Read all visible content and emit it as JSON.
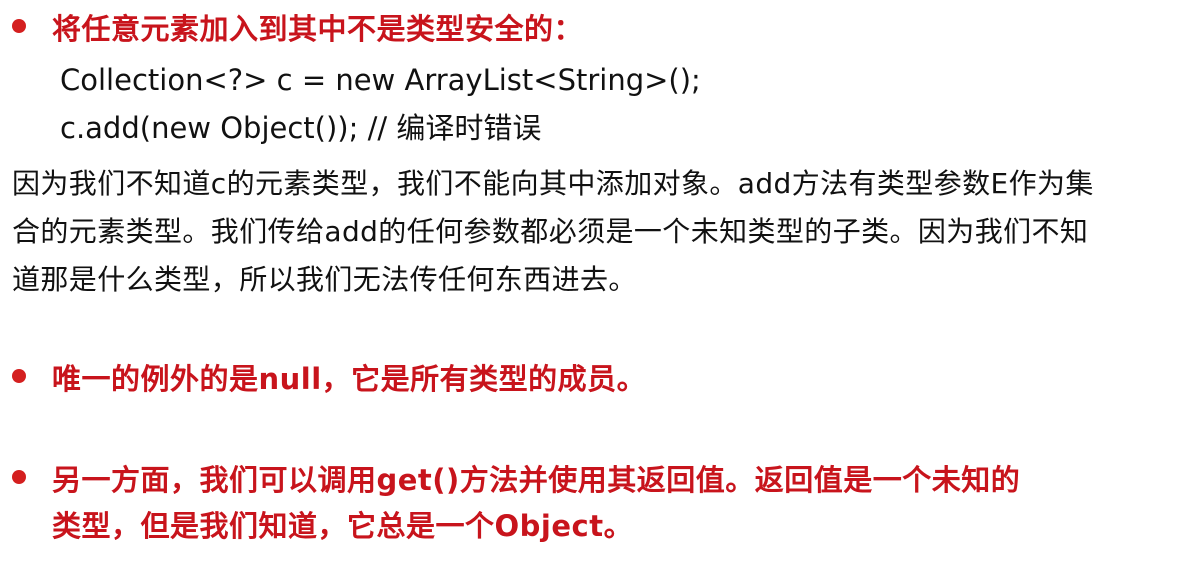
{
  "colors": {
    "accent_red": "#c8141c",
    "bullet_red": "#d41f1f",
    "body_text": "#111111",
    "background": "#ffffff"
  },
  "bullet1": {
    "icon": "red-bullet-dot",
    "text": "将任意元素加入到其中不是类型安全的："
  },
  "code": {
    "line1": "Collection<?> c = new ArrayList<String>();",
    "line2": "c.add(new Object()); // 编译时错误"
  },
  "paragraph": {
    "line1": "因为我们不知道c的元素类型，我们不能向其中添加对象。add方法有类型参数E作为集",
    "line2": "合的元素类型。我们传给add的任何参数都必须是一个未知类型的子类。因为我们不知",
    "line3": "道那是什么类型，所以我们无法传任何东西进去。"
  },
  "bullet2": {
    "icon": "red-bullet-dot",
    "text": "唯一的例外的是null，它是所有类型的成员。"
  },
  "bullet3": {
    "icon": "red-bullet-dot",
    "line1": "另一方面，我们可以调用get()方法并使用其返回值。返回值是一个未知的",
    "line2": "类型，但是我们知道，它总是一个Object。"
  }
}
